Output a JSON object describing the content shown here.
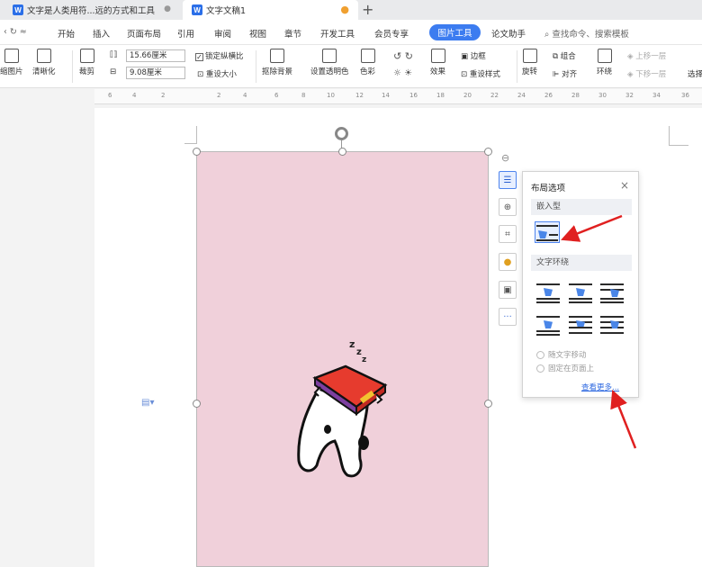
{
  "tabs": [
    {
      "label": "文字是人类用符...远的方式和工具",
      "active": false
    },
    {
      "label": "文字文稿1",
      "active": true
    }
  ],
  "menu": {
    "items": [
      "开始",
      "插入",
      "页面布局",
      "引用",
      "审阅",
      "视图",
      "章节",
      "开发工具",
      "会员专享"
    ],
    "active": "图片工具",
    "after": "论文助手",
    "search": "查找命令、搜索模板"
  },
  "toolbar": {
    "compress": "缩图片",
    "sharpen": "清晰化",
    "crop": "裁剪",
    "width_value": "15.66厘米",
    "height_value": "9.08厘米",
    "lock_ratio": "锁定纵横比",
    "reset_size": "重设大小",
    "remove_bg": "抠除背景",
    "transparent": "设置透明色",
    "color": "色彩",
    "effects": "效果",
    "border": "边框",
    "reset_style": "重设样式",
    "rotate": "旋转",
    "group": "组合",
    "align": "对齐",
    "wrap": "环绕",
    "bring_forward": "上移一层",
    "send_backward": "下移一层",
    "select": "选择"
  },
  "ruler_ticks": [
    "6",
    "4",
    "2",
    "2",
    "4",
    "6",
    "8",
    "10",
    "12",
    "14",
    "16",
    "18",
    "20",
    "22",
    "24",
    "26",
    "28",
    "30",
    "32",
    "34",
    "36"
  ],
  "popup": {
    "title": "布局选项",
    "close": "×",
    "inline_section": "嵌入型",
    "wrap_section": "文字环绕",
    "move_with_text": "随文字移动",
    "fix_on_page": "固定在页面上",
    "see_more": "查看更多..."
  },
  "side_tools": [
    "layout-options-icon",
    "zoom-icon",
    "crop-icon",
    "lightbulb-icon",
    "image-replace-icon",
    "more-icon"
  ],
  "colors": {
    "accent": "#3c7cf0",
    "image_bg": "#f0d0da",
    "arrow": "#e02020"
  }
}
